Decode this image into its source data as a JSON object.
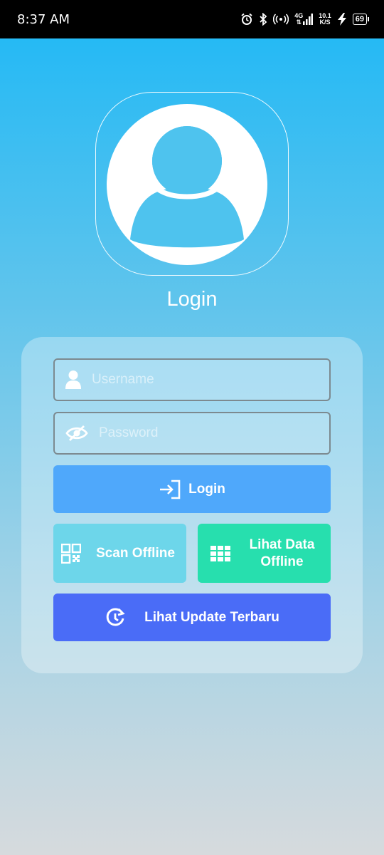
{
  "status_bar": {
    "time": "8:37 AM",
    "network_top": "4G",
    "speed_value": "10.1",
    "speed_unit": "K/S",
    "battery": "69"
  },
  "login": {
    "title": "Login",
    "username_placeholder": "Username",
    "password_placeholder": "Password",
    "login_button": "Login",
    "scan_offline_button": "Scan Offline",
    "lihat_data_offline_line1": "Lihat Data",
    "lihat_data_offline_line2": "Offline",
    "update_button": "Lihat Update Terbaru"
  },
  "colors": {
    "login_button": "#4fa8fb",
    "scan_button": "#6dd6ea",
    "data_button": "#27dfae",
    "update_button": "#4a6cf7"
  },
  "icons": {
    "avatar": "user-avatar-icon",
    "username": "user-icon",
    "password": "eye-slash-icon",
    "login": "sign-in-icon",
    "scan": "qr-code-icon",
    "data": "grid-icon",
    "update": "history-icon"
  }
}
